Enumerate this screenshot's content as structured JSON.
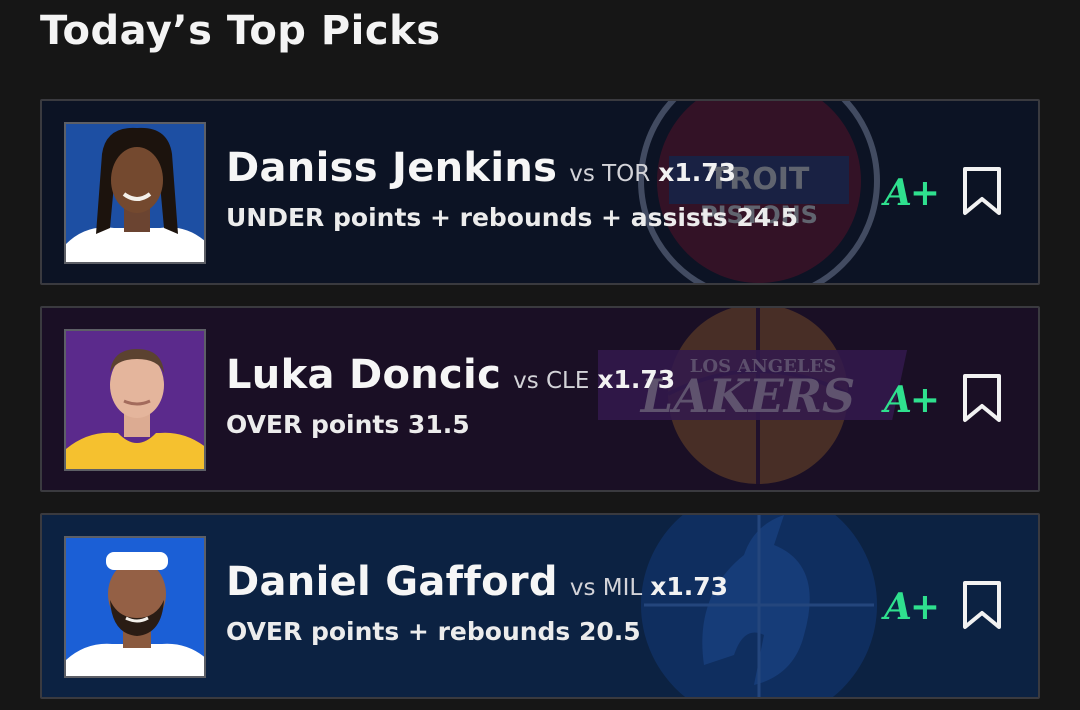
{
  "header": {
    "title": "Today’s Top Picks"
  },
  "picks": [
    {
      "player": "Daniss Jenkins",
      "opponent": "vs TOR",
      "multiplier": "x1.73",
      "prop": "UNDER points + rebounds + assists 24.5",
      "grade": "A+",
      "team_logo": "detroit-pistons-logo",
      "jersey_color": "#ffffff",
      "background": "#1d4fa3"
    },
    {
      "player": "Luka Doncic",
      "opponent": "vs CLE",
      "multiplier": "x1.73",
      "prop": "OVER points 31.5",
      "grade": "A+",
      "team_logo": "los-angeles-lakers-logo",
      "jersey_color": "#f5c12f",
      "background": "#5b2a8c"
    },
    {
      "player": "Daniel Gafford",
      "opponent": "vs MIL",
      "multiplier": "x1.73",
      "prop": "OVER points + rebounds 20.5",
      "grade": "A+",
      "team_logo": "dallas-mavericks-logo",
      "jersey_color": "#ffffff",
      "background": "#1b5fd6"
    }
  ],
  "colors": {
    "page_bg": "#161616",
    "grade_green": "#2fe08e",
    "card_border": "#3a3a3f"
  }
}
